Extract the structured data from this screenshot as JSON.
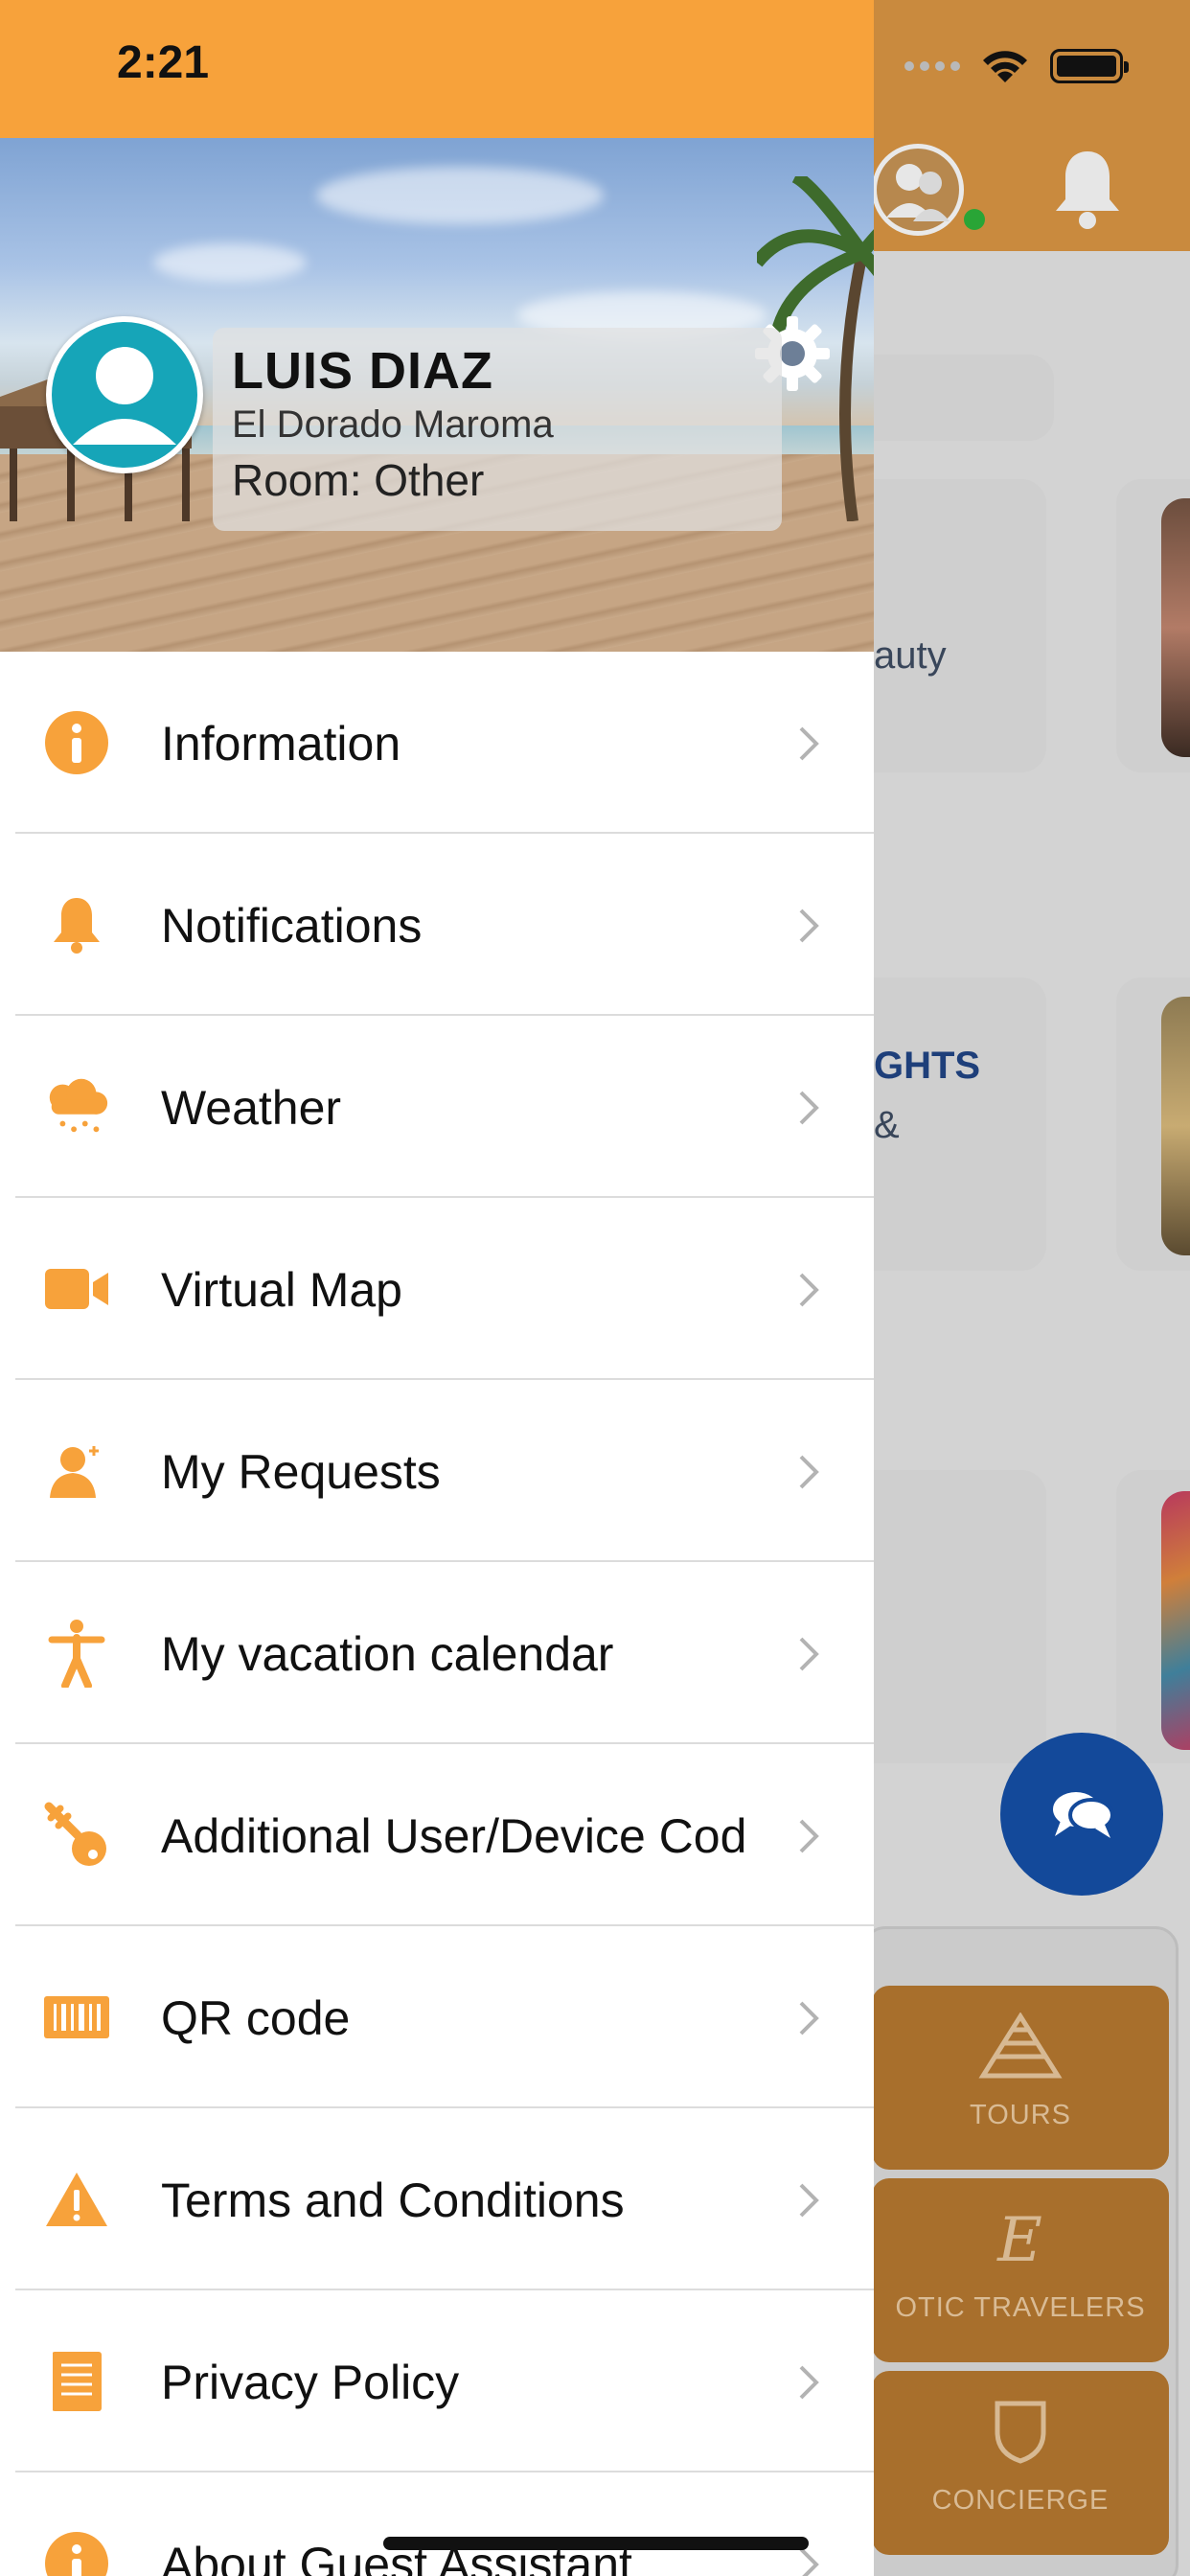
{
  "status_bar": {
    "time": "2:21"
  },
  "profile": {
    "name": "LUIS DIAZ",
    "hotel": "El Dorado Maroma",
    "room": "Room: Other"
  },
  "menu": {
    "items": [
      {
        "label": "Information",
        "icon": "info-icon"
      },
      {
        "label": "Notifications",
        "icon": "bell-icon"
      },
      {
        "label": "Weather",
        "icon": "weather-icon"
      },
      {
        "label": "Virtual Map",
        "icon": "video-camera-icon"
      },
      {
        "label": "My Requests",
        "icon": "person-request-icon"
      },
      {
        "label": "My vacation calendar",
        "icon": "person-activity-icon"
      },
      {
        "label": "Additional User/Device Cod",
        "icon": "key-icon"
      },
      {
        "label": "QR code",
        "icon": "barcode-icon"
      },
      {
        "label": "Terms and Conditions",
        "icon": "warning-icon"
      },
      {
        "label": "Privacy Policy",
        "icon": "document-icon"
      },
      {
        "label": "About Guest Assistant",
        "icon": "info-icon"
      }
    ]
  },
  "background": {
    "card_text_1": "auty",
    "card_text_2": "GHTS",
    "card_text_3": "&",
    "tiles": [
      {
        "label": "TOURS",
        "icon": "pyramid-icon"
      },
      {
        "label": "OTIC TRAVELERS",
        "icon": "letter-e-icon"
      },
      {
        "label": "CONCIERGE",
        "icon": "crest-icon"
      }
    ]
  },
  "colors": {
    "accent": "#f7a23b",
    "fab": "#13499a",
    "avatar": "#16a5b8",
    "online": "#29a536"
  }
}
